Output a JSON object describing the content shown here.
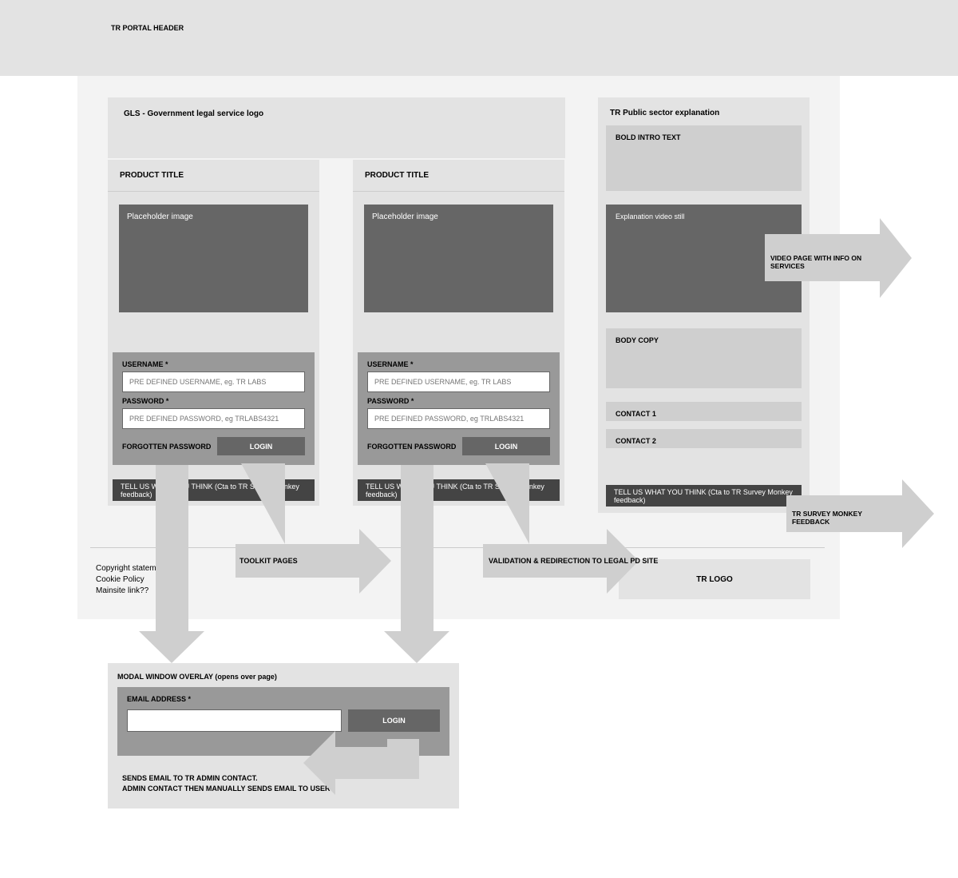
{
  "header": {
    "label": "TR PORTAL HEADER"
  },
  "gls_logo": "GLS - Government legal  service logo",
  "product": {
    "title": "PRODUCT TITLE",
    "placeholder": "Placeholder image",
    "username_label": "USERNAME *",
    "username_placeholder": "PRE DEFINED USERNAME, eg. TR LABS",
    "password_label": "PASSWORD *",
    "password_placeholder": "PRE DEFINED PASSWORD, eg TRLABS4321",
    "forgot": "FORGOTTEN PASSWORD",
    "login": "LOGIN",
    "feedback": "TELL US WHAT YOU THINK (Cta to TR Survey Monkey feedback)"
  },
  "side": {
    "title": "TR Public sector explanation",
    "intro": "BOLD INTRO TEXT",
    "video": "Explanation video still",
    "body": "BODY COPY",
    "contact1": "CONTACT 1",
    "contact2": "CONTACT 2",
    "feedback": "TELL US WHAT YOU THINK (Cta to TR Survey Monkey feedback)"
  },
  "footer": {
    "copyright": "Copyright statement",
    "cookie": "Cookie Policy",
    "mainsite": "Mainsite link??",
    "tr_logo": "TR LOGO"
  },
  "modal": {
    "title": "MODAL WINDOW OVERLAY (opens over page)",
    "email_label": "EMAIL ADDRESS *",
    "login": "LOGIN",
    "note1": "SENDS EMAIL TO TR ADMIN CONTACT.",
    "note2": "ADMIN CONTACT THEN MANUALLY SENDS EMAIL TO USER"
  },
  "callouts": {
    "toolkit": "TOOLKIT PAGES",
    "validation": "VALIDATION & REDIRECTION TO LEGAL PD SITE",
    "video_page": "VIDEO PAGE WITH INFO ON SERVICES",
    "survey": "TR SURVEY MONKEY FEEDBACK"
  }
}
